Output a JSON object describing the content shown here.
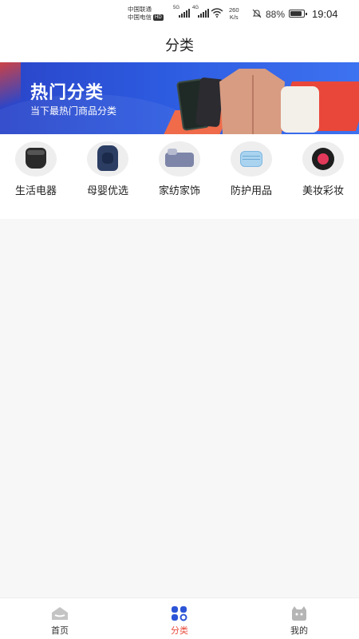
{
  "status_bar": {
    "carrier1": "中国联通",
    "carrier2": "中国电信",
    "hd_badge": "HD",
    "sig1_tag": "5G",
    "sig2_tag": "4G",
    "net_speed_value": "260",
    "net_speed_unit": "K/s",
    "battery": "88%",
    "battery_level": 0.88,
    "time": "19:04"
  },
  "header": {
    "title": "分类"
  },
  "banner": {
    "title": "热门分类",
    "subtitle": "当下最热门商品分类",
    "colors": {
      "blue": "#2d5be0",
      "red": "#e9473a"
    }
  },
  "categories": [
    {
      "label": "生活电器",
      "icon": "rice-cooker"
    },
    {
      "label": "母婴优选",
      "icon": "baby-car-seat"
    },
    {
      "label": "家纺家饰",
      "icon": "bedding"
    },
    {
      "label": "防护用品",
      "icon": "face-mask"
    },
    {
      "label": "美妆彩妆",
      "icon": "cosmetic-compact"
    }
  ],
  "tabbar": {
    "items": [
      {
        "label": "首页",
        "icon": "home-icon",
        "active": false
      },
      {
        "label": "分类",
        "icon": "category-icon",
        "active": true
      },
      {
        "label": "我的",
        "icon": "profile-icon",
        "active": false
      }
    ],
    "active_color": "#e84c3d",
    "inactive_color": "#b5b5b5"
  }
}
